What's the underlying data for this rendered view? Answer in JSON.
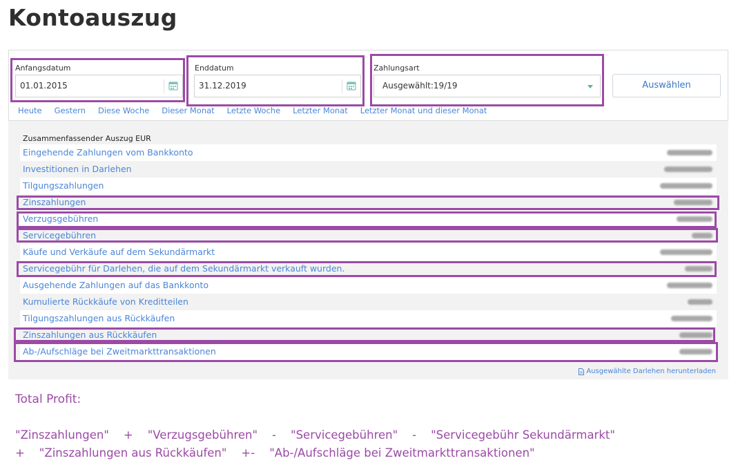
{
  "page": {
    "title": "Kontoauszug"
  },
  "filters": {
    "start": {
      "label": "Anfangsdatum",
      "value": "01.01.2015",
      "icon": "calendar-icon"
    },
    "end": {
      "label": "Enddatum",
      "value": "31.12.2019",
      "icon": "calendar-icon"
    },
    "payment_type": {
      "label": "Zahlungsart",
      "value": "Ausgewählt:19/19",
      "icon": "chevron-down-icon"
    },
    "submit_label": "Auswählen",
    "quick_links": [
      "Heute",
      "Gestern",
      "Diese Woche",
      "Dieser Monat",
      "Letzte Woche",
      "Letzter Monat",
      "Letzter Monat und dieser Monat"
    ]
  },
  "summary": {
    "heading": "Zusammenfassender Auszug EUR",
    "rows": [
      {
        "label": "Eingehende Zahlungen vom Bankkonto"
      },
      {
        "label": "Investitionen in Darlehen"
      },
      {
        "label": "Tilgungszahlungen"
      },
      {
        "label": "Zinszahlungen"
      },
      {
        "label": "Verzugsgebühren"
      },
      {
        "label": "Servicegebühren"
      },
      {
        "label": "Käufe und Verkäufe auf dem Sekundärmarkt"
      },
      {
        "label": "Servicegebühr für Darlehen, die auf dem Sekundärmarkt verkauft wurden."
      },
      {
        "label": "Ausgehende Zahlungen auf das Bankkonto"
      },
      {
        "label": "Kumulierte Rückkäufe von Kreditteilen"
      },
      {
        "label": "Tilgungszahlungen aus Rückkäufen"
      },
      {
        "label": "Zinszahlungen aus Rückkäufen"
      },
      {
        "label": "Ab-/Aufschläge bei Zweitmarkttransaktionen"
      }
    ],
    "download_label": "Ausgewählte Darlehen herunterladen",
    "download_icon": "document-icon"
  },
  "annotation": {
    "title": "Total Profit:",
    "line1": "\"Zinszahlungen\"    +    \"Verzugsgebühren\"    -    \"Servicegebühren\"    -    \"Servicegebühr Sekundärmarkt\"",
    "line2": "+    \"Zinszahlungen aus Rückkäufen\"    +-    \"Ab-/Aufschläge bei Zweitmarkttransaktionen\"",
    "color": "#9b4aa6"
  },
  "colors": {
    "accent": "#4a86d8",
    "highlight": "#9b4aa6"
  }
}
